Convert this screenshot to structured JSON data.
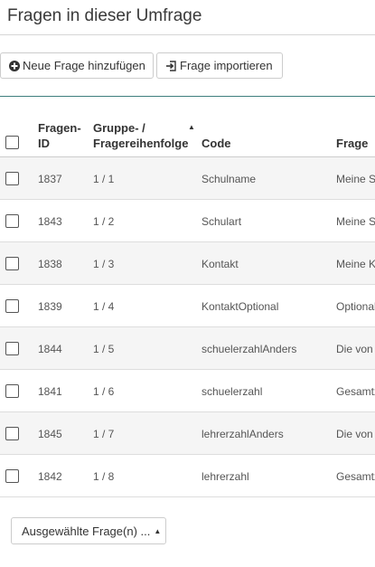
{
  "header": {
    "title": "Fragen in dieser Umfrage"
  },
  "toolbar": {
    "add_label": "Neue Frage hinzufügen",
    "import_label": "Frage importieren"
  },
  "table": {
    "columns": {
      "id_line1": "Fragen-",
      "id_line2": "ID",
      "group_line1": "Gruppe- /",
      "group_line2": "Fragereihenfolge",
      "code": "Code",
      "frage": "Frage"
    },
    "rows": [
      {
        "id": "1837",
        "group": "1 / 1",
        "code": "Schulname",
        "frage": "Meine S"
      },
      {
        "id": "1843",
        "group": "1 / 2",
        "code": "Schulart",
        "frage": "Meine S"
      },
      {
        "id": "1838",
        "group": "1 / 3",
        "code": "Kontakt",
        "frage": "Meine K"
      },
      {
        "id": "1839",
        "group": "1 / 4",
        "code": "KontaktOptional",
        "frage": "Optional"
      },
      {
        "id": "1844",
        "group": "1 / 5",
        "code": "schuelerzahlAnders",
        "frage": "Die von"
      },
      {
        "id": "1841",
        "group": "1 / 6",
        "code": "schuelerzahl",
        "frage": "Gesamtz"
      },
      {
        "id": "1845",
        "group": "1 / 7",
        "code": "lehrerzahlAnders",
        "frage": "Die von"
      },
      {
        "id": "1842",
        "group": "1 / 8",
        "code": "lehrerzahl",
        "frage": "Gesamtz"
      }
    ]
  },
  "bulk": {
    "label": "Ausgewählte Frage(n) ..."
  },
  "icons": {
    "add": "plus-circle-icon",
    "import": "import-icon",
    "sort": "sort-asc-icon",
    "caret": "caret-up-icon"
  }
}
